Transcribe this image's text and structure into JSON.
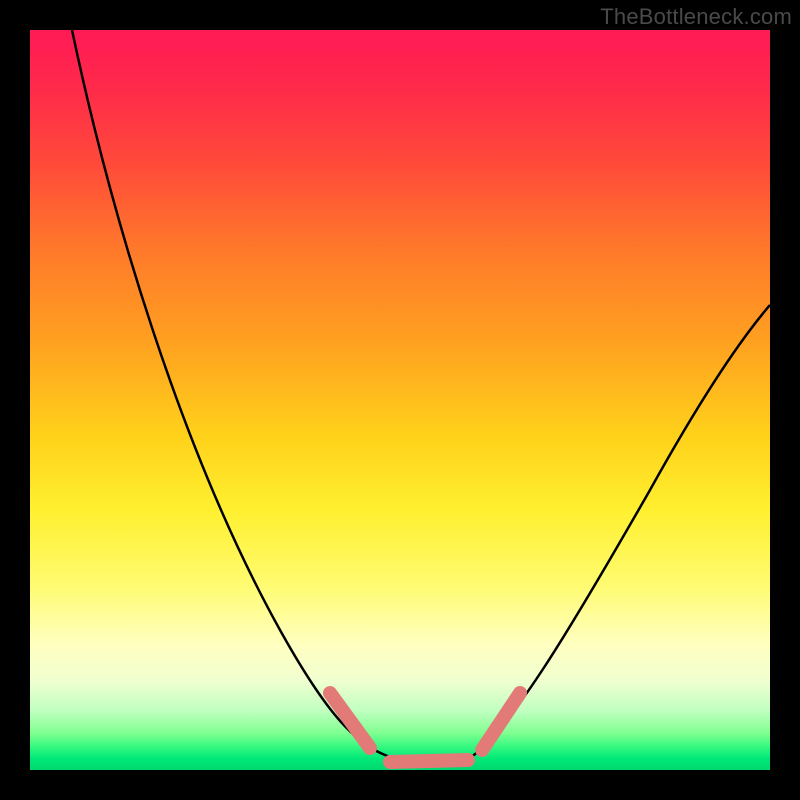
{
  "attribution": "TheBottleneck.com",
  "colors": {
    "curve": "#000000",
    "marker": "#e27a78",
    "frame": "#000000"
  },
  "chart_data": {
    "type": "line",
    "title": "",
    "xlabel": "",
    "ylabel": "",
    "xlim": [
      0,
      100
    ],
    "ylim": [
      0,
      100
    ],
    "grid": false,
    "legend": false,
    "series": [
      {
        "name": "curve",
        "x": [
          5,
          10,
          15,
          20,
          25,
          30,
          35,
          38,
          41,
          44,
          47,
          50,
          54,
          58,
          62,
          66,
          70,
          75,
          80,
          85,
          90,
          95,
          100
        ],
        "y": [
          100,
          88,
          76,
          65,
          54,
          43,
          32,
          25,
          18,
          12,
          7,
          3,
          1,
          0,
          0,
          3,
          8,
          15,
          23,
          32,
          41,
          50,
          59
        ]
      }
    ],
    "markers": [
      {
        "name": "left-descent-tip",
        "x": [
          38,
          44
        ],
        "y": [
          20,
          8
        ]
      },
      {
        "name": "valley-flat",
        "x": [
          47,
          58
        ],
        "y": [
          3,
          0
        ]
      },
      {
        "name": "right-ascent-tip",
        "x": [
          60,
          66
        ],
        "y": [
          1,
          10
        ]
      }
    ]
  }
}
